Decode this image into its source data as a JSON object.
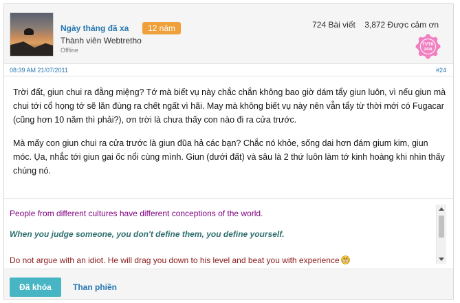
{
  "user": {
    "name": "Ngày tháng đã xa",
    "years_badge": "12 năm",
    "title": "Thành viên Webtretho",
    "status": "Offline",
    "posts": "724 Bài viết",
    "thanks": "3,872 Được cảm ơn",
    "award": {
      "line1": "TVTK",
      "line2": "2018",
      "color": "#f080c0"
    }
  },
  "post": {
    "date": "08:39 AM 21/07/2011",
    "number": "#24",
    "paragraphs": [
      "Trời đất, giun chui ra đằng miệng? Tớ mà biết vụ này chắc chắn không bao giờ dám tẩy giun luôn, vì nếu giun mà chui tới cổ họng tớ sẽ lăn đùng ra chết ngất vì hãi. May mà không biết vụ này nên vẫn tẩy từ thời mới có Fugacar (cũng hơn 10 năm thì phải?), ơn trời là chưa thấy con nào đi ra cửa trước.",
      "Mà mấy con giun chui ra cửa trước là giun đũa hả các bạn? Chắc nó khỏe, sống dai hơn đám gium kim, giun móc. Ụa, nhắc tới giun gai ốc nổi cùng mình. Giun (dưới đất) và sâu là 2 thứ luôn làm tớ kinh hoàng khi nhìn thấy chúng nó."
    ]
  },
  "signature": {
    "line1": "People from different cultures have different conceptions of the world.",
    "line2": "When you judge someone, you don't define them, you define yourself.",
    "line3": "Do not argue with an idiot. He will drag you down to his level and beat you with experience",
    "emoji_icon": "grinning-face-icon"
  },
  "footer": {
    "locked_label": "Đã khóa",
    "complain_label": "Than phiền"
  },
  "colors": {
    "accent": "#2577b1",
    "badge": "#f0a03a",
    "button": "#47b5c4"
  }
}
